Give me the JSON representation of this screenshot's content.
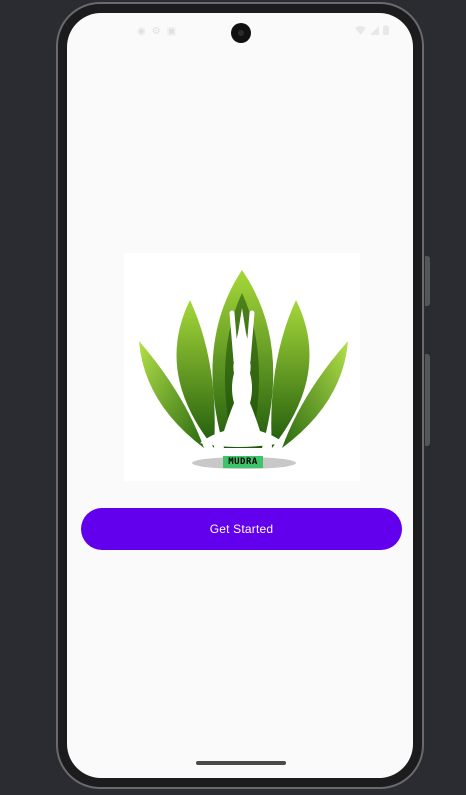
{
  "app": {
    "brand_name": "MUDRA",
    "cta_label": "Get Started"
  },
  "status_bar": {
    "time": "",
    "left_icons": [
      "notification-icon",
      "settings-icon",
      "storage-icon"
    ],
    "right_icons": [
      "wifi-icon",
      "signal-icon",
      "battery-icon"
    ]
  },
  "colors": {
    "accent": "#6200ee",
    "leaf_light": "#9acd32",
    "leaf_dark": "#1e5a0a",
    "brand_tag": "#3ec36a",
    "background": "#fafafa"
  }
}
